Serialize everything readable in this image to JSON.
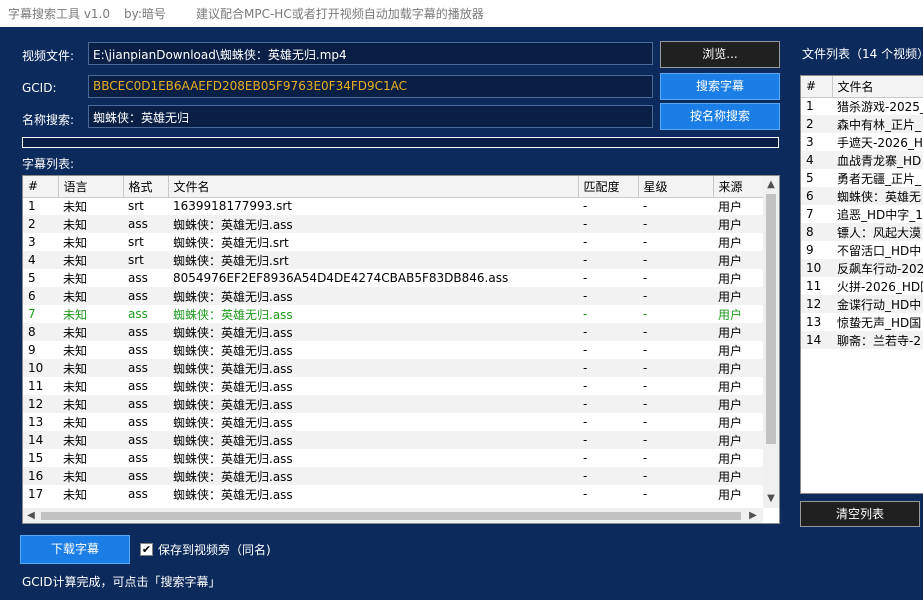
{
  "titlebar": {
    "app_title": "字幕搜索工具 v1.0",
    "author": "by:暗号",
    "hint": "建议配合MPC-HC或者打开视频自动加载字幕的播放器"
  },
  "form": {
    "video_label": "视频文件:",
    "video_value": "E:\\jianpianDownload\\蜘蛛侠：英雄无归.mp4",
    "gcid_label": "GCID:",
    "gcid_value": "BBCEC0D1EB6AAEFD208EB05F9763E0F34FD9C1AC",
    "name_label": "名称搜索:",
    "name_value": "蜘蛛侠：英雄无归",
    "browse_label": "浏览...",
    "search_label": "搜索字幕",
    "name_search_label": "按名称搜索",
    "progress": 0
  },
  "subtitles": {
    "label": "字幕列表:",
    "columns": [
      "#",
      "语言",
      "格式",
      "文件名",
      "匹配度",
      "星级",
      "来源"
    ],
    "rows": [
      [
        "1",
        "未知",
        "srt",
        "1639918177993.srt",
        "-",
        "-",
        "用户"
      ],
      [
        "2",
        "未知",
        "ass",
        "蜘蛛侠：英雄无归.ass",
        "-",
        "-",
        "用户"
      ],
      [
        "3",
        "未知",
        "srt",
        "蜘蛛侠：英雄无归.srt",
        "-",
        "-",
        "用户"
      ],
      [
        "4",
        "未知",
        "srt",
        "蜘蛛侠：英雄无归.srt",
        "-",
        "-",
        "用户"
      ],
      [
        "5",
        "未知",
        "ass",
        "8054976EF2EF8936A54D4DE4274CBAB5F83DB846.ass",
        "-",
        "-",
        "用户"
      ],
      [
        "6",
        "未知",
        "ass",
        "蜘蛛侠：英雄无归.ass",
        "-",
        "-",
        "用户"
      ],
      [
        "7",
        "未知",
        "ass",
        "蜘蛛侠：英雄无归.ass",
        "-",
        "-",
        "用户"
      ],
      [
        "8",
        "未知",
        "ass",
        "蜘蛛侠：英雄无归.ass",
        "-",
        "-",
        "用户"
      ],
      [
        "9",
        "未知",
        "ass",
        "蜘蛛侠：英雄无归.ass",
        "-",
        "-",
        "用户"
      ],
      [
        "10",
        "未知",
        "ass",
        "蜘蛛侠：英雄无归.ass",
        "-",
        "-",
        "用户"
      ],
      [
        "11",
        "未知",
        "ass",
        "蜘蛛侠：英雄无归.ass",
        "-",
        "-",
        "用户"
      ],
      [
        "12",
        "未知",
        "ass",
        "蜘蛛侠：英雄无归.ass",
        "-",
        "-",
        "用户"
      ],
      [
        "13",
        "未知",
        "ass",
        "蜘蛛侠：英雄无归.ass",
        "-",
        "-",
        "用户"
      ],
      [
        "14",
        "未知",
        "ass",
        "蜘蛛侠：英雄无归.ass",
        "-",
        "-",
        "用户"
      ],
      [
        "15",
        "未知",
        "ass",
        "蜘蛛侠：英雄无归.ass",
        "-",
        "-",
        "用户"
      ],
      [
        "16",
        "未知",
        "ass",
        "蜘蛛侠：英雄无归.ass",
        "-",
        "-",
        "用户"
      ],
      [
        "17",
        "未知",
        "ass",
        "蜘蛛侠：英雄无归.ass",
        "-",
        "-",
        "用户"
      ]
    ],
    "selected_index": 6
  },
  "files": {
    "label": "文件列表（14 个视频）",
    "columns": [
      "#",
      "文件名"
    ],
    "rows": [
      [
        "1",
        "猎杀游戏-2025_"
      ],
      [
        "2",
        "森中有林_正片_"
      ],
      [
        "3",
        "手遮天-2026_HD"
      ],
      [
        "4",
        "血战青龙寨_HD"
      ],
      [
        "5",
        "勇者无疆_正片_"
      ],
      [
        "6",
        "蜘蛛侠：英雄无"
      ],
      [
        "7",
        "追恶_HD中字_1("
      ],
      [
        "8",
        "镖人：风起大漠"
      ],
      [
        "9",
        "不留活口_HD中"
      ],
      [
        "10",
        "反飙车行动-202"
      ],
      [
        "11",
        "火拼-2026_HD国"
      ],
      [
        "12",
        "金谍行动_HD中"
      ],
      [
        "13",
        "惊蛰无声_HD国"
      ],
      [
        "14",
        "聊斋：兰若寺-2"
      ]
    ],
    "clear_label": "清空列表"
  },
  "bottom": {
    "download_label": "下载字幕",
    "save_next_label": "保存到视频旁（同名)",
    "save_next_checked": true,
    "status_text": "GCID计算完成，可点击「搜索字幕」"
  },
  "colors": {
    "background": "#0c2a5c",
    "accent_blue": "#1a7ee6",
    "gcid_text": "#e8b020",
    "selected_row_text": "#1e9a1e"
  }
}
